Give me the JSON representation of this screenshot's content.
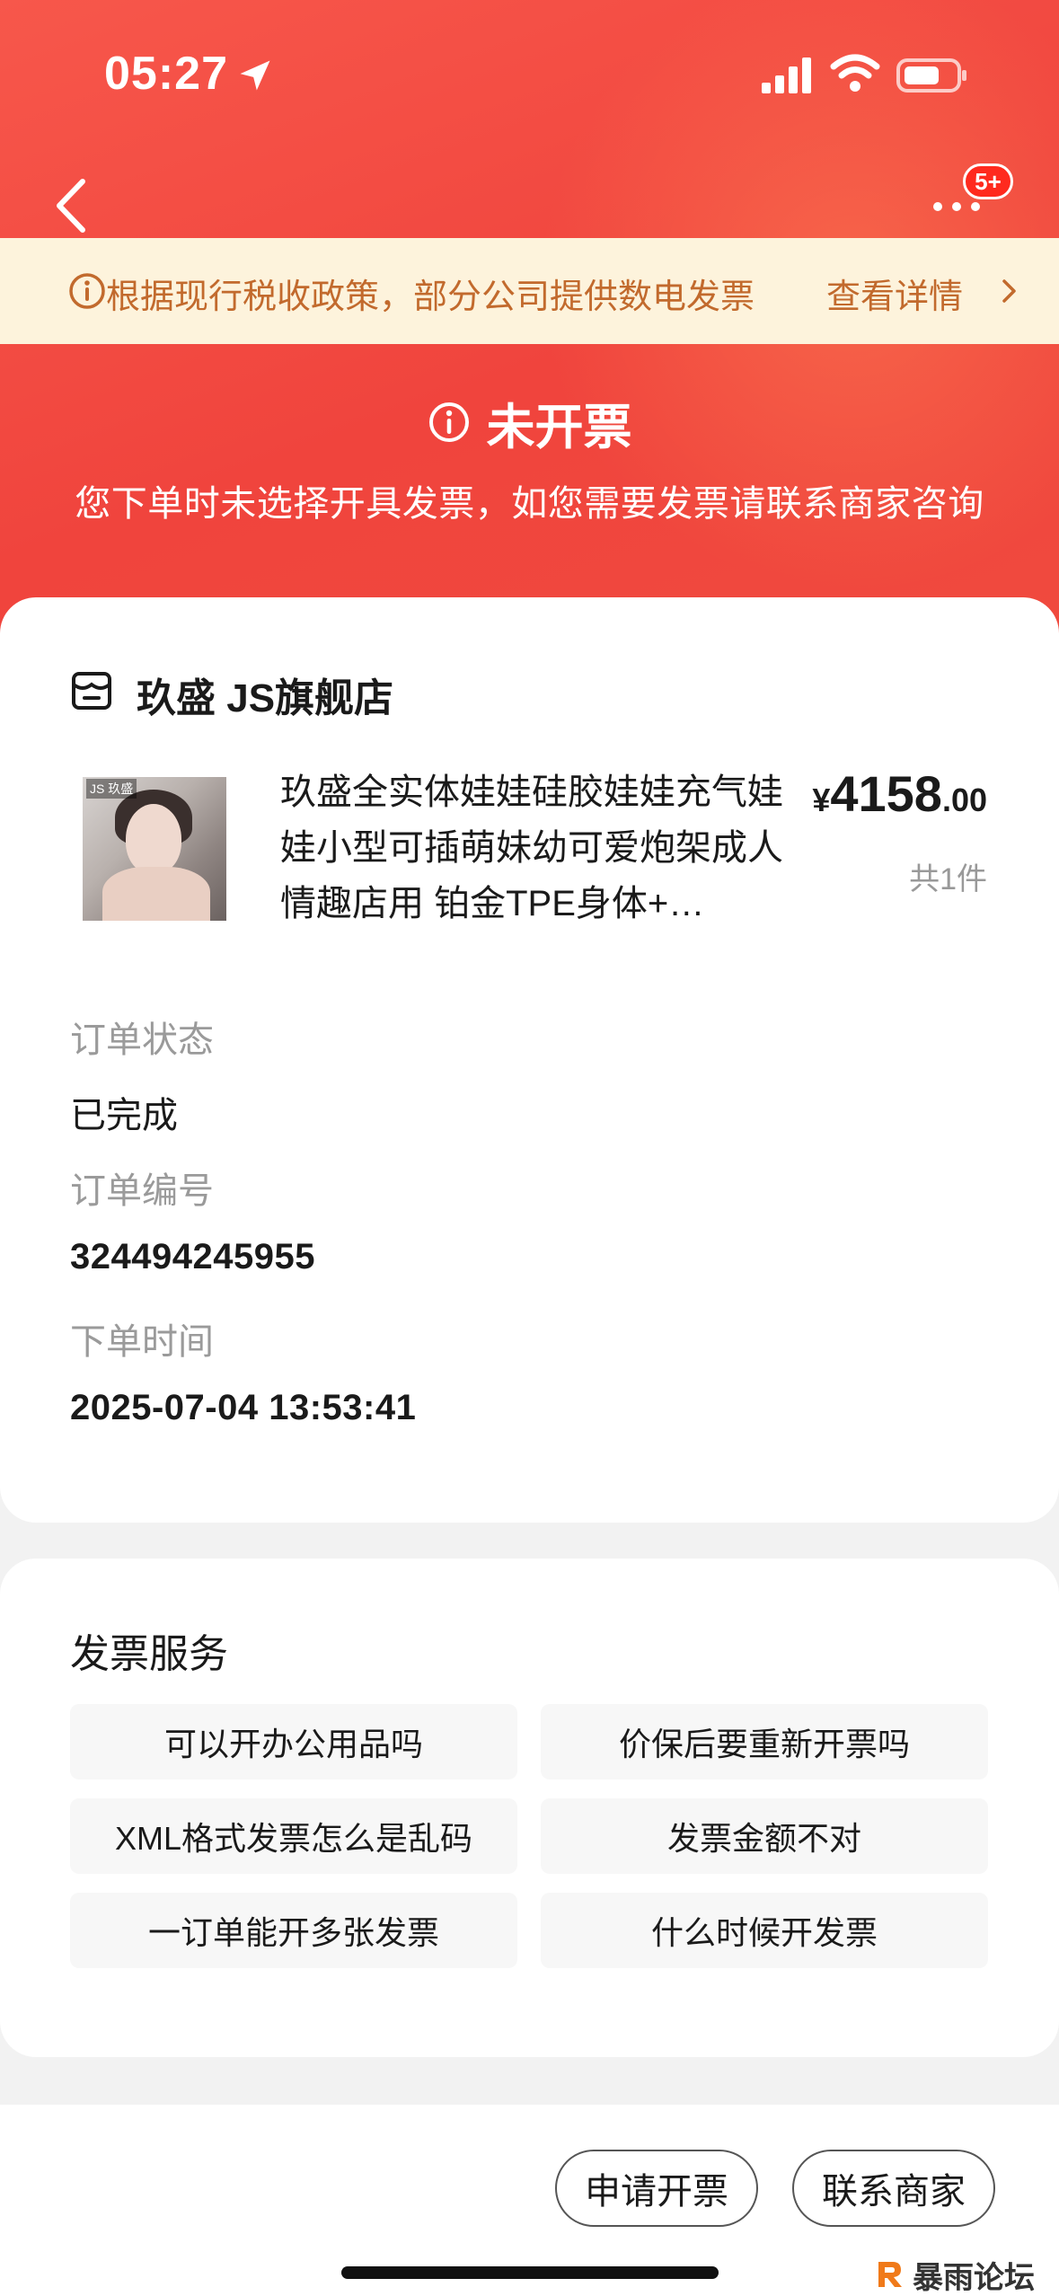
{
  "status_bar": {
    "time": "05:27"
  },
  "nav": {
    "badge": "5+"
  },
  "notice": {
    "text": "根据现行税收政策，部分公司提供数电发票",
    "link": "查看详情"
  },
  "invoice_status": {
    "title": "未开票",
    "subtitle": "您下单时未选择开具发票，如您需要发票请联系商家咨询"
  },
  "order": {
    "shop_name": "玖盛 JS旗舰店",
    "product": {
      "title": "玖盛全实体娃娃硅胶娃娃充气娃娃小型可插萌妹幼可爱炮架成人情趣店用 铂金TPE身体+…",
      "price_currency": "¥",
      "price_integer": "4158",
      "price_decimal": ".00",
      "quantity": "共1件",
      "thumb_logo": "JS 玖盛"
    },
    "fields": [
      {
        "label": "订单状态",
        "value": "已完成"
      },
      {
        "label": "订单编号",
        "value": "324494245955"
      },
      {
        "label": "下单时间",
        "value": "2025-07-04 13:53:41"
      }
    ]
  },
  "invoice_service": {
    "title": "发票服务",
    "questions": [
      "可以开办公用品吗",
      "价保后要重新开票吗",
      "XML格式发票怎么是乱码",
      "发票金额不对",
      "一订单能开多张发票",
      "什么时候开发票"
    ]
  },
  "actions": {
    "apply_label": "申请开票",
    "contact_label": "联系商家"
  },
  "watermark": {
    "text": "暴雨论坛"
  },
  "colors": {
    "header_red": "#f04a3e",
    "notice_bg": "#fdf3dc",
    "notice_text": "#c26a2d",
    "watermark_orange": "#f07a1a"
  }
}
